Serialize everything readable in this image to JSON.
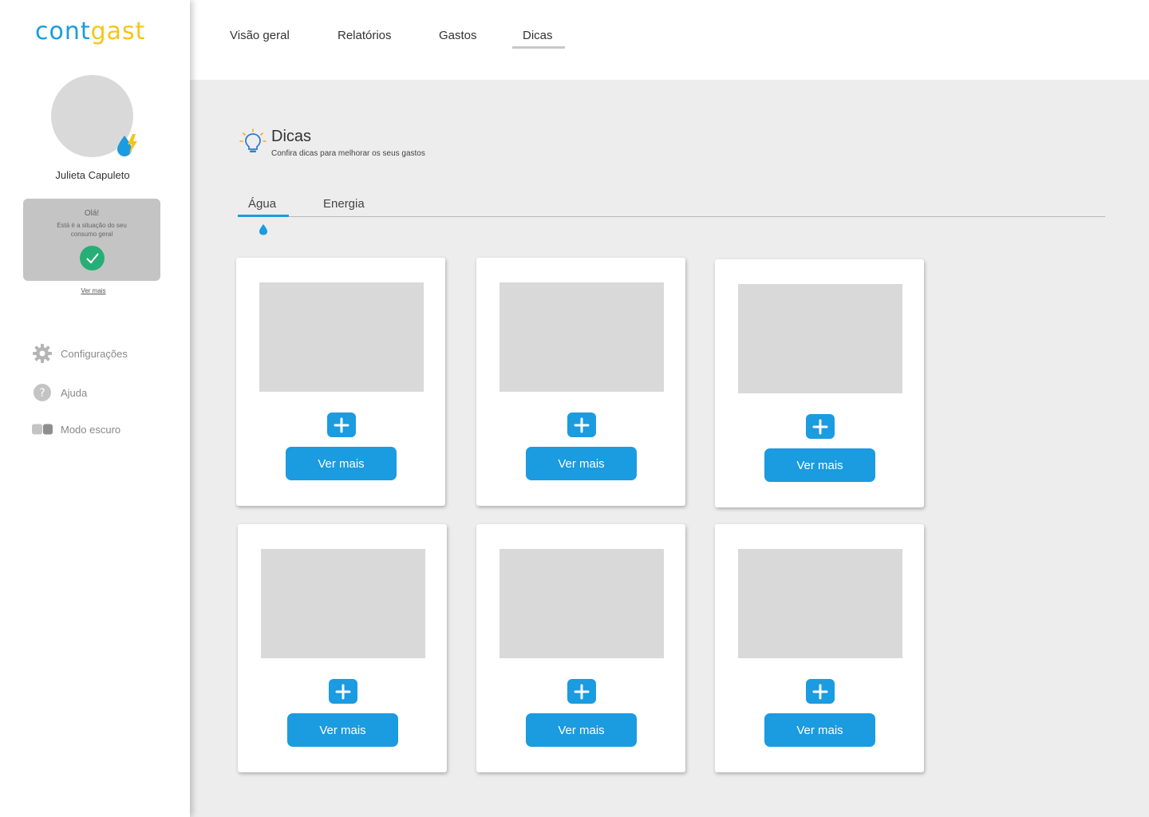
{
  "app": {
    "logo_part1": "cont",
    "logo_part2": "gast"
  },
  "user": {
    "name": "Julieta Capuleto"
  },
  "status_card": {
    "greeting": "Olá!",
    "description": "Está é a situação do seu consumo geral",
    "status": "ok",
    "link": "Ver mais"
  },
  "menu": [
    {
      "label": "Configurações",
      "icon": "gear-icon"
    },
    {
      "label": "Ajuda",
      "icon": "help-icon"
    },
    {
      "label": "Modo escuro",
      "icon": "toggle-icon"
    }
  ],
  "top_nav": {
    "tabs": [
      "Visão geral",
      "Relatórios",
      "Gastos",
      "Dicas"
    ],
    "active": "Dicas"
  },
  "section": {
    "title": "Dicas",
    "subtitle": "Confira dicas para melhorar os seus gastos",
    "icon": "lightbulb-icon"
  },
  "sub_tabs": {
    "items": [
      "Água",
      "Energia"
    ],
    "active": "Água"
  },
  "cards": [
    {
      "button": "Ver mais"
    },
    {
      "button": "Ver mais"
    },
    {
      "button": "Ver mais"
    },
    {
      "button": "Ver mais"
    },
    {
      "button": "Ver mais"
    },
    {
      "button": "Ver mais"
    }
  ],
  "colors": {
    "accent": "#1b9be0",
    "logo_yellow": "#f5c518",
    "success": "#27ae76",
    "placeholder": "#d9d9d9"
  }
}
